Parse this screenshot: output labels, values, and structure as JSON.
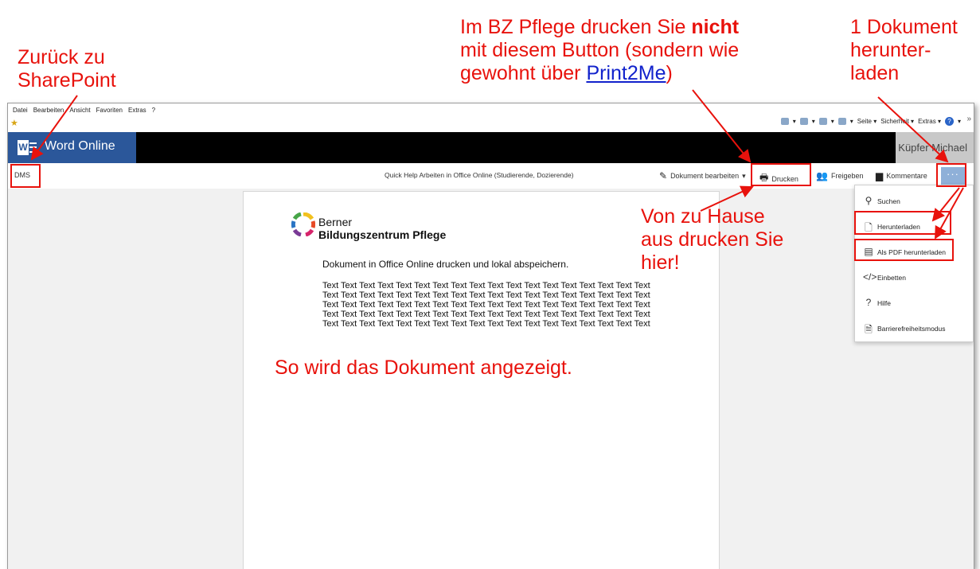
{
  "annotations": {
    "back_to_sharepoint": [
      "Zurück zu",
      "SharePoint"
    ],
    "print_note": {
      "line1_pre": "Im BZ Pflege drucken Sie ",
      "line1_bold": "nicht",
      "line2": "mit diesem Button (sondern wie",
      "line3_pre": "gewohnt über ",
      "line3_link": "Print2Me",
      "line3_post": ")"
    },
    "download_note": [
      "1 Dokument",
      "herunter-",
      "laden"
    ],
    "home_print_note": [
      "Von zu Hause",
      "aus drucken Sie",
      "hier!"
    ],
    "display_note": "So wird das Dokument angezeigt."
  },
  "ie_menu": [
    "Datei",
    "Bearbeiten",
    "Ansicht",
    "Favoriten",
    "Extras",
    "?"
  ],
  "ie_commands": {
    "seite": "Seite ▾",
    "sicherheit": "Sicherheit ▾",
    "extras": "Extras ▾"
  },
  "suite": {
    "app_name": "Word Online",
    "user": "Küpfer Michael"
  },
  "toolbar": {
    "breadcrumb": "DMS",
    "doc_title": "Quick Help Arbeiten in Office Online (Studierende, Dozierende)",
    "edit": "Dokument bearbeiten",
    "print": "Drucken",
    "share": "Freigeben",
    "comments": "Kommentare",
    "more": "···"
  },
  "document": {
    "org_line1": "Berner",
    "org_line2": "Bildungszentrum Pflege",
    "intro": "Dokument in Office Online drucken und lokal abspeichern.",
    "filler_lines": [
      "Text Text Text Text Text Text Text Text Text Text Text Text Text Text Text Text Text Text",
      "Text Text Text Text Text Text Text Text Text Text Text Text Text Text Text Text Text Text",
      "Text Text Text Text Text Text Text Text Text Text Text Text Text Text Text Text Text Text",
      "Text Text Text Text Text Text Text Text Text Text Text Text Text Text Text Text Text Text",
      "Text Text Text Text Text Text Text Text Text Text Text Text Text Text Text Text Text Text"
    ]
  },
  "menu": {
    "items": [
      {
        "label": "Suchen",
        "icon": "search-icon"
      },
      {
        "label": "Herunterladen",
        "icon": "document-icon"
      },
      {
        "label": "Als PDF herunterladen",
        "icon": "pdf-icon"
      },
      {
        "label": "Einbetten",
        "icon": "embed-icon"
      },
      {
        "label": "Hilfe",
        "icon": "help-icon"
      },
      {
        "label": "Barrierefreiheitsmodus",
        "icon": "accessibility-icon"
      }
    ]
  },
  "colors": {
    "annotation": "#e8120c",
    "link": "#1122cc",
    "word_blue": "#2b579a",
    "more_button": "#8fb0d8"
  }
}
